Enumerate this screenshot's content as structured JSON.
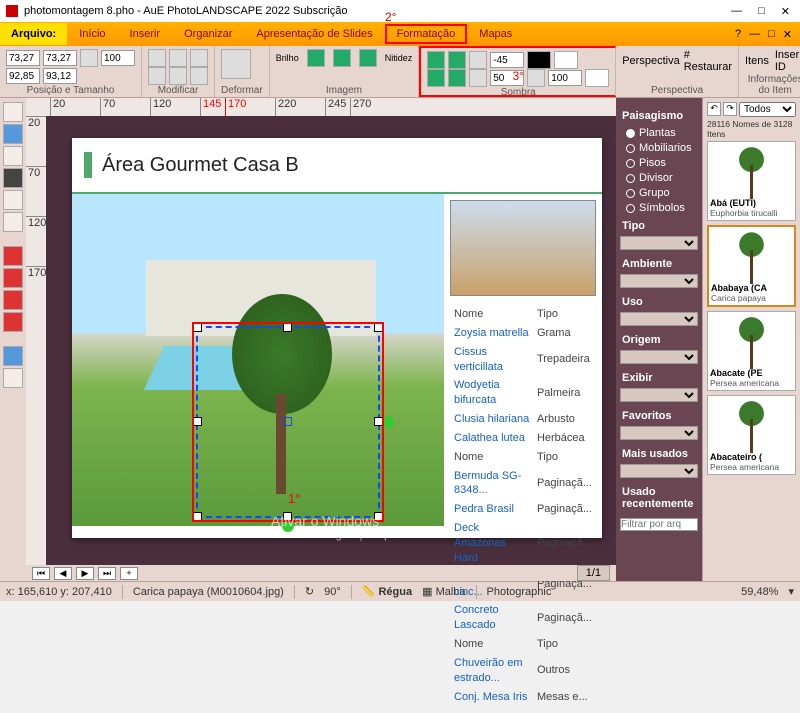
{
  "window": {
    "title": "photomontagem 8.pho - AuE PhotoLANDSCAPE 2022 Subscrição"
  },
  "menu": {
    "file": "Arquivo:",
    "items": [
      "Início",
      "Inserir",
      "Organizar",
      "Apresentação de Slides",
      "Formatação",
      "Mapas"
    ],
    "anno2": "2°"
  },
  "ribbon": {
    "pos": {
      "label": "Posição e Tamanho",
      "x": "73,27",
      "y": "92,85",
      "w": "73,27",
      "h": "93,12",
      "val": "100"
    },
    "mod": {
      "label": "Modificar"
    },
    "def": {
      "label": "Deformar"
    },
    "img": {
      "label": "Imagem",
      "brilho": "Brilho",
      "nitidez": "Nitidez"
    },
    "sombra": {
      "label": "Sombra",
      "a": "-45",
      "b": "50",
      "c": "100",
      "anno3": "3°"
    },
    "persp": {
      "label": "Perspectiva",
      "p": "Perspectiva",
      "r": "# Restaurar"
    },
    "info": {
      "label": "Informações do Item",
      "itens": "Itens",
      "ins": "Inserir ID"
    }
  },
  "page": {
    "title": "Área Gourmet Casa B",
    "anno1": "1°",
    "table_head": [
      "Nome",
      "Tipo"
    ],
    "table": [
      [
        "Zoysia matrella",
        "Grama"
      ],
      [
        "Cissus verticillata",
        "Trepadeira"
      ],
      [
        "Wodyetia bifurcata",
        "Palmeira"
      ],
      [
        "Clusia hilariana",
        "Arbusto"
      ],
      [
        "Calathea lutea",
        "Herbácea"
      ],
      [
        "Nome",
        "Tipo"
      ],
      [
        "Bermuda SG-8348...",
        "Paginaçã..."
      ],
      [
        "Pedra Brasil",
        "Paginaçã..."
      ],
      [
        "Deck Amazonas Hard",
        "Paginaçã..."
      ],
      [
        "Pedra britada cinc...",
        "Paginaçã..."
      ],
      [
        "Concreto Lascado",
        "Paginaçã..."
      ],
      [
        "Nome",
        "Tipo"
      ],
      [
        "Chuveirão em estrado...",
        "Outros"
      ],
      [
        "Conj. Mesa Iris",
        "Mesas e..."
      ]
    ]
  },
  "nav": {
    "page": "1/1"
  },
  "filter": {
    "heading": "Paisagismo",
    "radios": [
      "Plantas",
      "Mobiliarios",
      "Pisos",
      "Divisor",
      "Grupo",
      "Símbolos"
    ],
    "selected": 0,
    "sections": [
      "Tipo",
      "Ambiente",
      "Uso",
      "Origem",
      "Exibir",
      "Favoritos",
      "Mais usados",
      "Usado recentemente"
    ],
    "search": "Filtrar por arq"
  },
  "library": {
    "filter": "Todos",
    "count": "28116 Nomes de 3128 Itens",
    "items": [
      {
        "name": "Abá (EUTI)",
        "sci": "Euphorbia tirucalli"
      },
      {
        "name": "Ababaya (CA",
        "sci": "Carica papaya"
      },
      {
        "name": "Abacate (PE",
        "sci": "Persea americana"
      },
      {
        "name": "Abacateiro (",
        "sci": "Persea americana"
      }
    ]
  },
  "status": {
    "coords": "x: 165,610    y: 207,410",
    "item": "Carica papaya (M0010604.jpg)",
    "angle": "90°",
    "regua": "Régua",
    "malha": "Malha",
    "photo": "Photographic",
    "zoom": "59,48%"
  },
  "watermark": {
    "l1": "Ativar o Windows",
    "l2": "Acesse Configurações para ativar o Windows."
  },
  "ruler_h": [
    "20",
    "70",
    "120",
    "145",
    "170",
    "220",
    "245",
    "270"
  ],
  "ruler_v": [
    "20",
    "70",
    "120",
    "170"
  ]
}
